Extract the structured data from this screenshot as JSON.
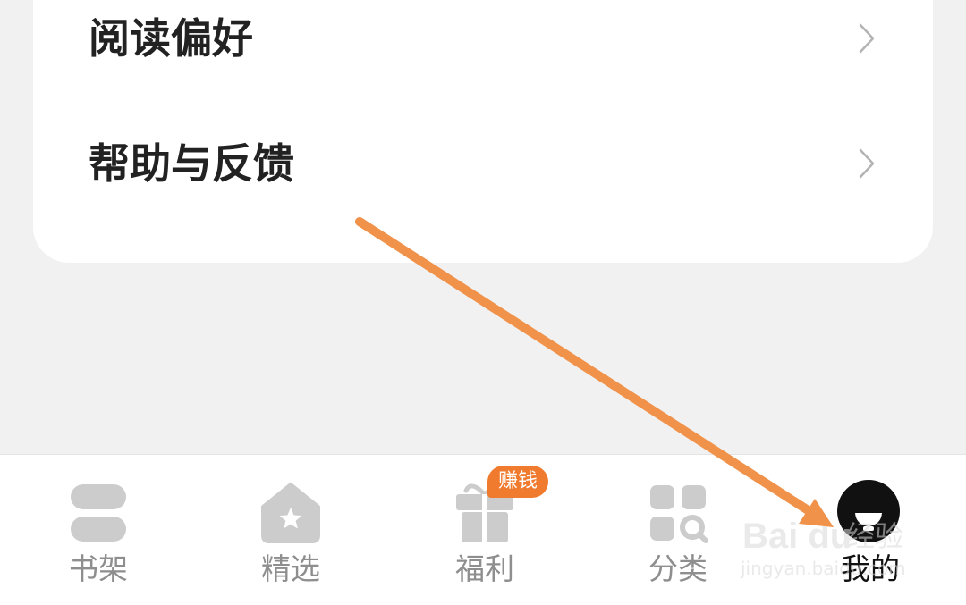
{
  "settings": {
    "items": [
      {
        "label": "阅读偏好",
        "icon": "chevron-right-icon"
      },
      {
        "label": "帮助与反馈",
        "icon": "chevron-right-icon"
      }
    ]
  },
  "tabbar": {
    "tabs": [
      {
        "label": "书架",
        "icon": "bookshelf-icon",
        "active": false
      },
      {
        "label": "精选",
        "icon": "featured-house-star-icon",
        "active": false
      },
      {
        "label": "福利",
        "icon": "gift-icon",
        "active": false,
        "badge": "赚钱"
      },
      {
        "label": "分类",
        "icon": "category-grid-icon",
        "active": false
      },
      {
        "label": "我的",
        "icon": "avatar",
        "active": true
      }
    ]
  },
  "watermark": {
    "logo": "Bai du",
    "text": "经验",
    "url": "jingyan.baidu.com"
  },
  "colors": {
    "background": "#f1f1f1",
    "card": "#ffffff",
    "text_primary": "#222222",
    "tab_inactive": "#8e8e8e",
    "tab_active": "#111111",
    "icon_inactive": "#cccccc",
    "badge": "#f07a2d",
    "annotation_arrow": "#f0924a"
  }
}
